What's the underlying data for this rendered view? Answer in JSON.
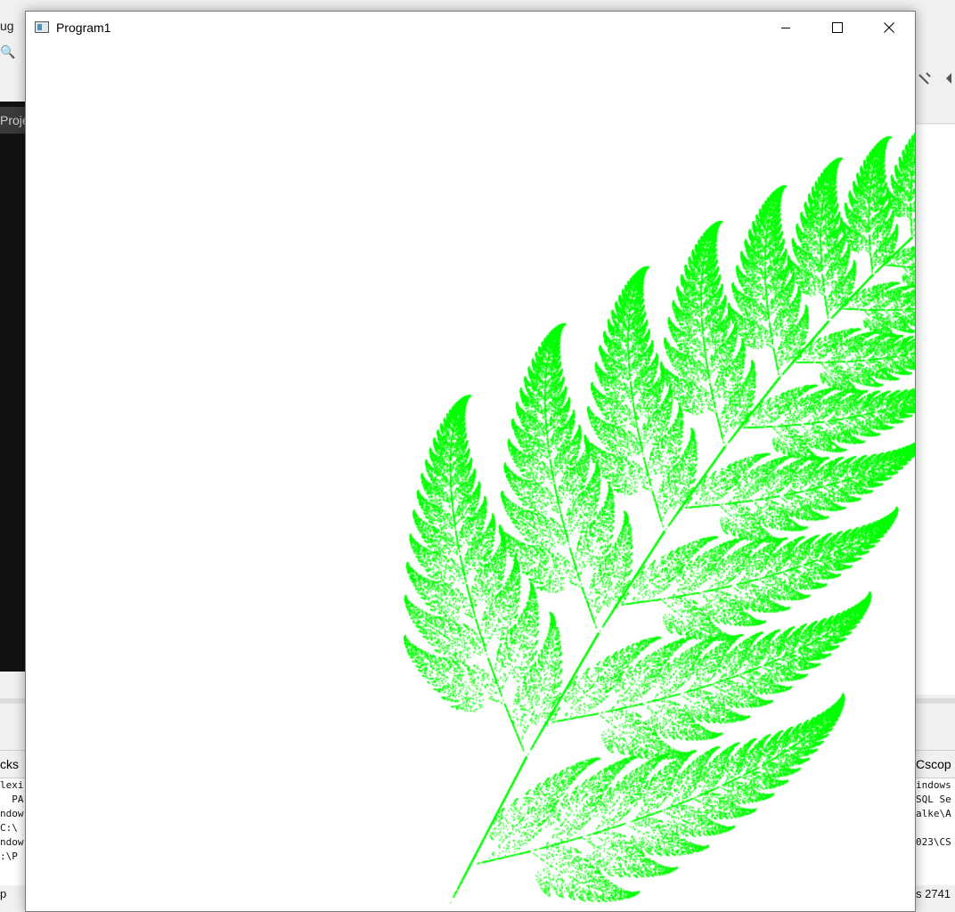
{
  "background_ide": {
    "menu_fragment": "ug",
    "project_tab_fragment": "Proje",
    "left_tab_fragment": "cks",
    "right_tab_fragment": "Cscop",
    "left_log_lines": [
      "lexi",
      "  PA",
      "ndow",
      "C:\\",
      "ndow",
      ":\\P"
    ],
    "right_log_lines": [
      "indows",
      "SQL Se",
      "alke\\A",
      "",
      "023\\CS"
    ],
    "status_left_fragment": "p",
    "status_right_fragment": "s 2741"
  },
  "window": {
    "title": "Program1",
    "minimize_label": "Minimize",
    "maximize_label": "Maximize",
    "close_label": "Close"
  },
  "fractal": {
    "name": "Barnsley fern",
    "color": "#00ff00",
    "background": "#ffffff"
  }
}
